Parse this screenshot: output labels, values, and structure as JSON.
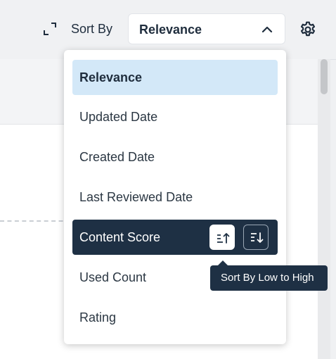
{
  "header": {
    "sort_by_label": "Sort By",
    "selected_sort": "Relevance"
  },
  "dropdown": {
    "options": [
      {
        "label": "Relevance",
        "state": "selected"
      },
      {
        "label": "Updated Date"
      },
      {
        "label": "Created Date"
      },
      {
        "label": "Last Reviewed Date"
      },
      {
        "label": "Content Score",
        "state": "active"
      },
      {
        "label": "Used Count"
      },
      {
        "label": "Rating"
      }
    ]
  },
  "tooltip": {
    "text": "Sort By Low to High"
  },
  "icons": [
    "expand-icon",
    "chevron-up-icon",
    "gear-icon",
    "sort-ascending-icon",
    "sort-descending-icon"
  ],
  "colors": {
    "selected_option_bg": "#d3e8f8",
    "active_option_bg": "#1e3044",
    "tooltip_bg": "#1e3044"
  }
}
